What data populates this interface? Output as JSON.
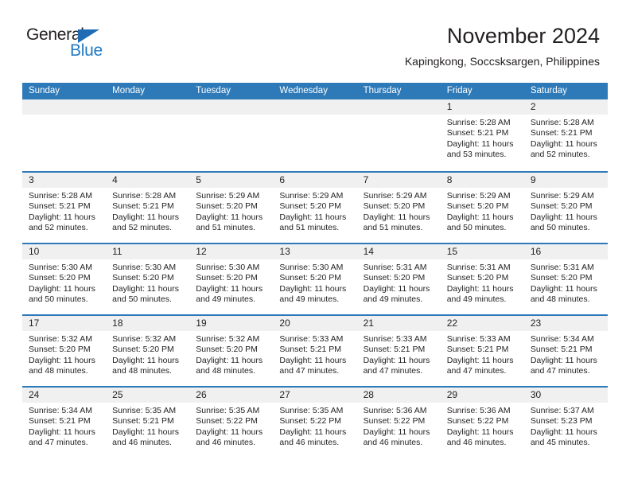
{
  "brand": {
    "name_part1": "General",
    "name_part2": "Blue",
    "triangle_color": "#1f6cb4",
    "blue_color": "#1f7ac4"
  },
  "header": {
    "title": "November 2024",
    "subtitle": "Kapingkong, Soccsksargen, Philippines"
  },
  "theme": {
    "header_blue": "#2e7ab8",
    "row_divider_blue": "#2e7ab8",
    "daynum_strip": "#f0f0f0",
    "text": "#231f20"
  },
  "weekdays": [
    "Sunday",
    "Monday",
    "Tuesday",
    "Wednesday",
    "Thursday",
    "Friday",
    "Saturday"
  ],
  "labels": {
    "sunrise_prefix": "Sunrise:",
    "sunset_prefix": "Sunset:",
    "daylight_prefix": "Daylight:"
  },
  "weeks": [
    [
      {
        "day": "",
        "empty": true
      },
      {
        "day": "",
        "empty": true
      },
      {
        "day": "",
        "empty": true
      },
      {
        "day": "",
        "empty": true
      },
      {
        "day": "",
        "empty": true
      },
      {
        "day": "1",
        "sunrise": "Sunrise: 5:28 AM",
        "sunset": "Sunset: 5:21 PM",
        "daylight": "Daylight: 11 hours and 53 minutes."
      },
      {
        "day": "2",
        "sunrise": "Sunrise: 5:28 AM",
        "sunset": "Sunset: 5:21 PM",
        "daylight": "Daylight: 11 hours and 52 minutes."
      }
    ],
    [
      {
        "day": "3",
        "sunrise": "Sunrise: 5:28 AM",
        "sunset": "Sunset: 5:21 PM",
        "daylight": "Daylight: 11 hours and 52 minutes."
      },
      {
        "day": "4",
        "sunrise": "Sunrise: 5:28 AM",
        "sunset": "Sunset: 5:21 PM",
        "daylight": "Daylight: 11 hours and 52 minutes."
      },
      {
        "day": "5",
        "sunrise": "Sunrise: 5:29 AM",
        "sunset": "Sunset: 5:20 PM",
        "daylight": "Daylight: 11 hours and 51 minutes."
      },
      {
        "day": "6",
        "sunrise": "Sunrise: 5:29 AM",
        "sunset": "Sunset: 5:20 PM",
        "daylight": "Daylight: 11 hours and 51 minutes."
      },
      {
        "day": "7",
        "sunrise": "Sunrise: 5:29 AM",
        "sunset": "Sunset: 5:20 PM",
        "daylight": "Daylight: 11 hours and 51 minutes."
      },
      {
        "day": "8",
        "sunrise": "Sunrise: 5:29 AM",
        "sunset": "Sunset: 5:20 PM",
        "daylight": "Daylight: 11 hours and 50 minutes."
      },
      {
        "day": "9",
        "sunrise": "Sunrise: 5:29 AM",
        "sunset": "Sunset: 5:20 PM",
        "daylight": "Daylight: 11 hours and 50 minutes."
      }
    ],
    [
      {
        "day": "10",
        "sunrise": "Sunrise: 5:30 AM",
        "sunset": "Sunset: 5:20 PM",
        "daylight": "Daylight: 11 hours and 50 minutes."
      },
      {
        "day": "11",
        "sunrise": "Sunrise: 5:30 AM",
        "sunset": "Sunset: 5:20 PM",
        "daylight": "Daylight: 11 hours and 50 minutes."
      },
      {
        "day": "12",
        "sunrise": "Sunrise: 5:30 AM",
        "sunset": "Sunset: 5:20 PM",
        "daylight": "Daylight: 11 hours and 49 minutes."
      },
      {
        "day": "13",
        "sunrise": "Sunrise: 5:30 AM",
        "sunset": "Sunset: 5:20 PM",
        "daylight": "Daylight: 11 hours and 49 minutes."
      },
      {
        "day": "14",
        "sunrise": "Sunrise: 5:31 AM",
        "sunset": "Sunset: 5:20 PM",
        "daylight": "Daylight: 11 hours and 49 minutes."
      },
      {
        "day": "15",
        "sunrise": "Sunrise: 5:31 AM",
        "sunset": "Sunset: 5:20 PM",
        "daylight": "Daylight: 11 hours and 49 minutes."
      },
      {
        "day": "16",
        "sunrise": "Sunrise: 5:31 AM",
        "sunset": "Sunset: 5:20 PM",
        "daylight": "Daylight: 11 hours and 48 minutes."
      }
    ],
    [
      {
        "day": "17",
        "sunrise": "Sunrise: 5:32 AM",
        "sunset": "Sunset: 5:20 PM",
        "daylight": "Daylight: 11 hours and 48 minutes."
      },
      {
        "day": "18",
        "sunrise": "Sunrise: 5:32 AM",
        "sunset": "Sunset: 5:20 PM",
        "daylight": "Daylight: 11 hours and 48 minutes."
      },
      {
        "day": "19",
        "sunrise": "Sunrise: 5:32 AM",
        "sunset": "Sunset: 5:20 PM",
        "daylight": "Daylight: 11 hours and 48 minutes."
      },
      {
        "day": "20",
        "sunrise": "Sunrise: 5:33 AM",
        "sunset": "Sunset: 5:21 PM",
        "daylight": "Daylight: 11 hours and 47 minutes."
      },
      {
        "day": "21",
        "sunrise": "Sunrise: 5:33 AM",
        "sunset": "Sunset: 5:21 PM",
        "daylight": "Daylight: 11 hours and 47 minutes."
      },
      {
        "day": "22",
        "sunrise": "Sunrise: 5:33 AM",
        "sunset": "Sunset: 5:21 PM",
        "daylight": "Daylight: 11 hours and 47 minutes."
      },
      {
        "day": "23",
        "sunrise": "Sunrise: 5:34 AM",
        "sunset": "Sunset: 5:21 PM",
        "daylight": "Daylight: 11 hours and 47 minutes."
      }
    ],
    [
      {
        "day": "24",
        "sunrise": "Sunrise: 5:34 AM",
        "sunset": "Sunset: 5:21 PM",
        "daylight": "Daylight: 11 hours and 47 minutes."
      },
      {
        "day": "25",
        "sunrise": "Sunrise: 5:35 AM",
        "sunset": "Sunset: 5:21 PM",
        "daylight": "Daylight: 11 hours and 46 minutes."
      },
      {
        "day": "26",
        "sunrise": "Sunrise: 5:35 AM",
        "sunset": "Sunset: 5:22 PM",
        "daylight": "Daylight: 11 hours and 46 minutes."
      },
      {
        "day": "27",
        "sunrise": "Sunrise: 5:35 AM",
        "sunset": "Sunset: 5:22 PM",
        "daylight": "Daylight: 11 hours and 46 minutes."
      },
      {
        "day": "28",
        "sunrise": "Sunrise: 5:36 AM",
        "sunset": "Sunset: 5:22 PM",
        "daylight": "Daylight: 11 hours and 46 minutes."
      },
      {
        "day": "29",
        "sunrise": "Sunrise: 5:36 AM",
        "sunset": "Sunset: 5:22 PM",
        "daylight": "Daylight: 11 hours and 46 minutes."
      },
      {
        "day": "30",
        "sunrise": "Sunrise: 5:37 AM",
        "sunset": "Sunset: 5:23 PM",
        "daylight": "Daylight: 11 hours and 45 minutes."
      }
    ]
  ]
}
